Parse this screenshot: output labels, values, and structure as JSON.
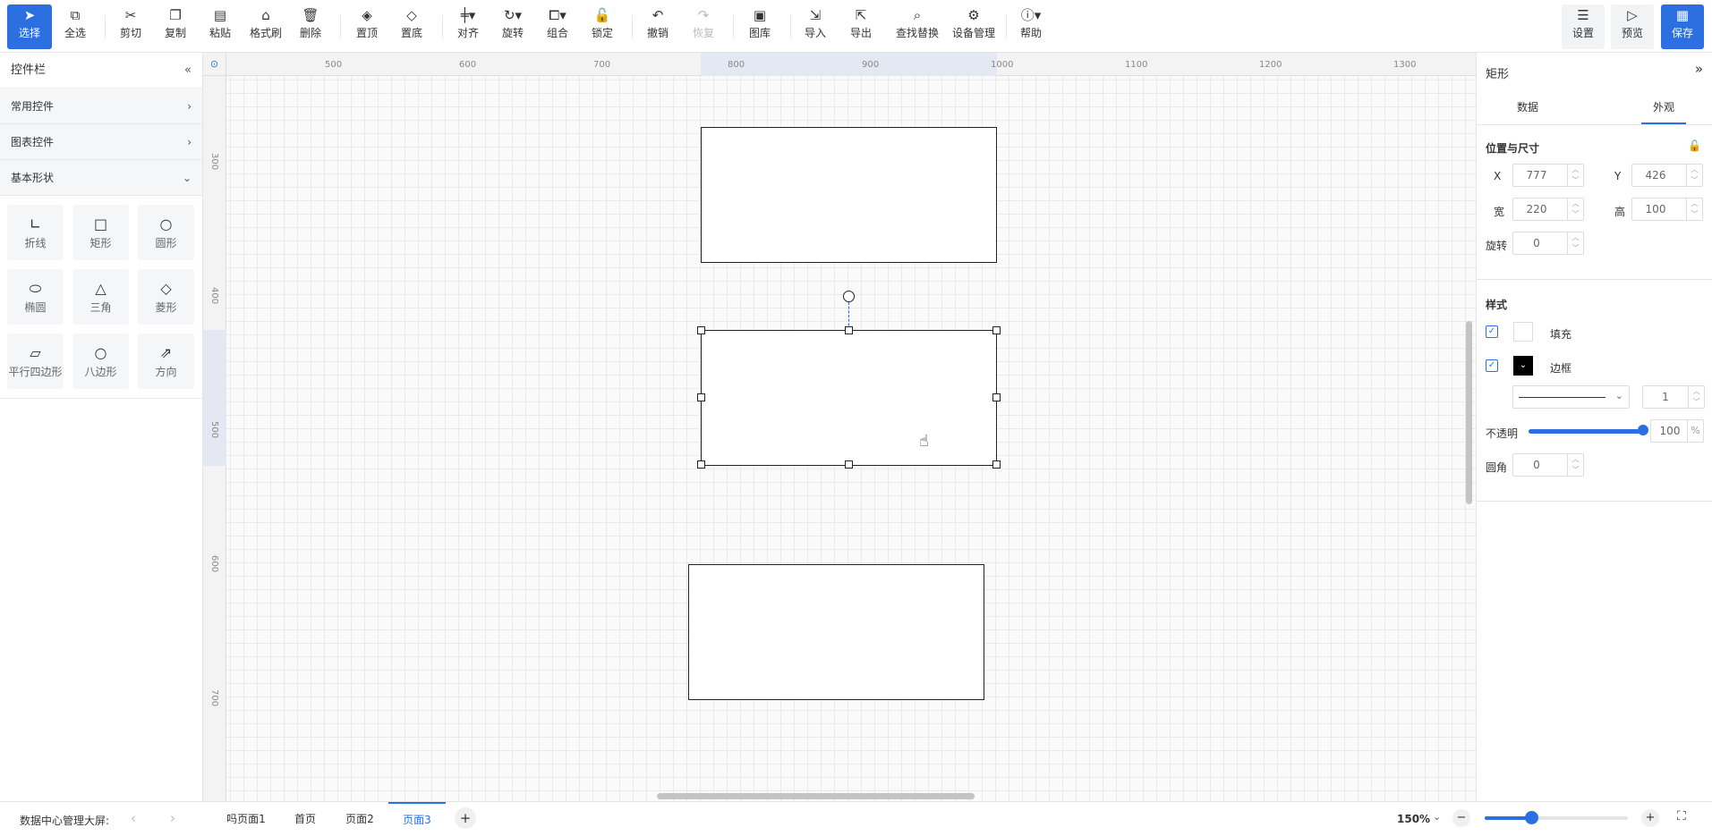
{
  "toolbar": {
    "items": [
      {
        "label": "选择",
        "icon": "cursor-icon"
      },
      {
        "label": "全选",
        "icon": "select-all-icon"
      },
      {
        "label": "剪切",
        "icon": "scissors-icon"
      },
      {
        "label": "复制",
        "icon": "copy-icon"
      },
      {
        "label": "粘贴",
        "icon": "paste-icon"
      },
      {
        "label": "格式刷",
        "icon": "format-brush-icon"
      },
      {
        "label": "删除",
        "icon": "trash-icon"
      },
      {
        "label": "置顶",
        "icon": "bring-front-icon"
      },
      {
        "label": "置底",
        "icon": "send-back-icon"
      },
      {
        "label": "对齐",
        "icon": "align-icon"
      },
      {
        "label": "旋转",
        "icon": "rotate-icon"
      },
      {
        "label": "组合",
        "icon": "group-icon"
      },
      {
        "label": "锁定",
        "icon": "lock-icon"
      },
      {
        "label": "撤销",
        "icon": "undo-icon"
      },
      {
        "label": "恢复",
        "icon": "redo-icon"
      },
      {
        "label": "图库",
        "icon": "image-library-icon"
      },
      {
        "label": "导入",
        "icon": "import-icon"
      },
      {
        "label": "导出",
        "icon": "export-icon"
      },
      {
        "label": "查找替换",
        "icon": "search-replace-icon"
      },
      {
        "label": "设备管理",
        "icon": "device-manage-icon"
      },
      {
        "label": "帮助",
        "icon": "help-icon"
      }
    ],
    "settings": "设置",
    "preview": "预览",
    "save": "保存"
  },
  "left": {
    "title": "控件栏",
    "categories": [
      "常用控件",
      "图表控件",
      "基本形状"
    ],
    "shapes": [
      "折线",
      "矩形",
      "圆形",
      "椭圆",
      "三角",
      "菱形",
      "平行四边形",
      "八边形",
      "方向"
    ]
  },
  "ruler": {
    "top": [
      "500",
      "600",
      "700",
      "800",
      "900",
      "1000",
      "1100",
      "1200",
      "1300"
    ],
    "left": [
      "300",
      "400",
      "500",
      "600",
      "700"
    ]
  },
  "right": {
    "title": "矩形",
    "tabs": [
      "数据",
      "外观"
    ],
    "pos_title": "位置与尺寸",
    "x_label": "X",
    "x": "777",
    "y_label": "Y",
    "y": "426",
    "w_label": "宽",
    "w": "220",
    "h_label": "高",
    "h": "100",
    "rot_label": "旋转",
    "rot": "0",
    "style_title": "样式",
    "fill_label": "填充",
    "border_label": "边框",
    "border_width": "1",
    "opacity_label": "不透明",
    "opacity": "100",
    "opacity_unit": "%",
    "radius_label": "圆角",
    "radius": "0"
  },
  "bottom": {
    "project": "数据中心管理大屏:",
    "pages": [
      "吗页面1",
      "首页",
      "页面2",
      "页面3"
    ],
    "zoom": "150%"
  }
}
